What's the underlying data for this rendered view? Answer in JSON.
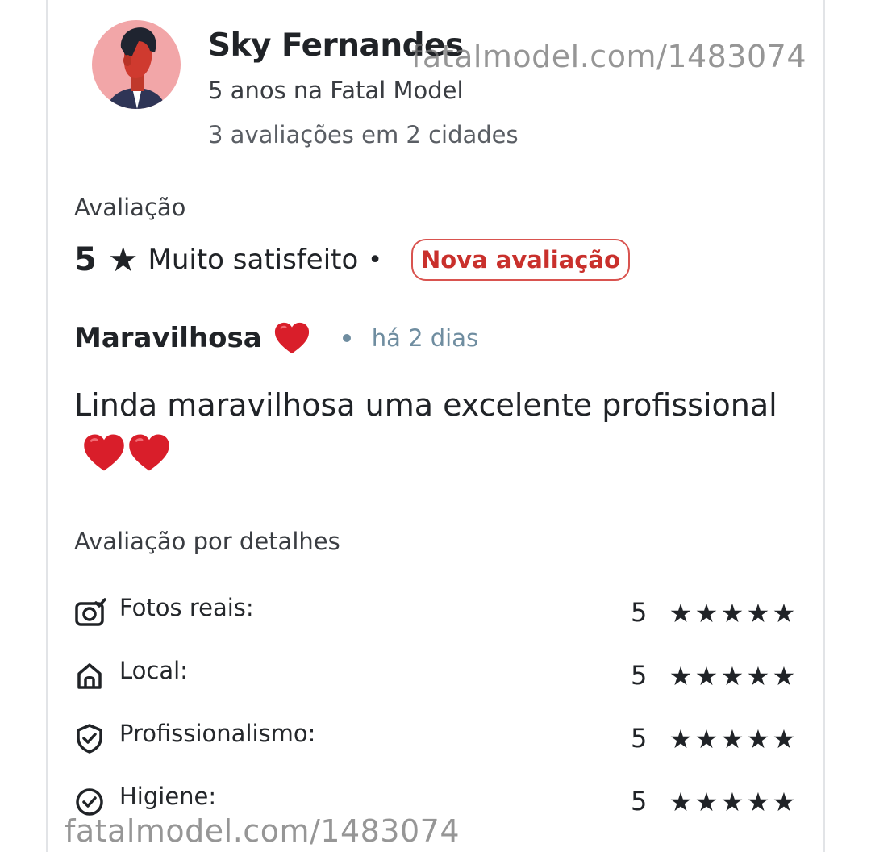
{
  "reviewer": {
    "name": "Sky Fernandes",
    "tenure": "5 anos na Fatal Model",
    "stats": "3 avaliações em 2 cidades",
    "avatar_icon": "person-avatar-icon"
  },
  "rating": {
    "label": "Avaliação",
    "score": "5",
    "star": "★",
    "sentiment": "Muito satisfeito",
    "separator": "•",
    "badge": "Nova avaliação"
  },
  "review": {
    "title": "Maravilhosa",
    "time_ago": "há 2 dias",
    "body": "Linda maravilhosa uma excelente profissional"
  },
  "details": {
    "label": "Avaliação por detalhes",
    "items": [
      {
        "icon": "camera-check-icon",
        "label": "Fotos reais:",
        "score": "5",
        "stars": 5
      },
      {
        "icon": "home-icon",
        "label": "Local:",
        "score": "5",
        "stars": 5
      },
      {
        "icon": "shield-check-icon",
        "label": "Profissionalismo:",
        "score": "5",
        "stars": 5
      },
      {
        "icon": "check-circle-icon",
        "label": "Higiene:",
        "score": "5",
        "stars": 5
      }
    ]
  },
  "watermark": {
    "top": "fatalmodel.com/1483074",
    "bottom": "fatalmodel.com/1483074"
  },
  "colors": {
    "badge": "#c9302c",
    "time": "#6f8da0",
    "heart": "#d91e2a",
    "avatar_bg": "#f0a5a5"
  }
}
